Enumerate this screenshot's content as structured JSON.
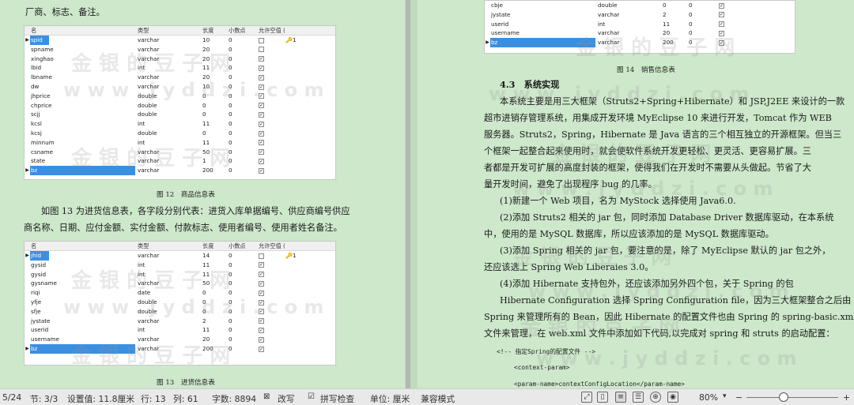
{
  "left": {
    "intro": "厂商、标志、备注。",
    "para": [
      "如图 13 为进货信息表，各字段分别代表：进货入库单据编号、供应商编号供应",
      "商名称、日期、应付金额、实付金额、付款标志、使用者编号、使用者姓名备注。"
    ],
    "cap12": "图 12　商品信息表",
    "cap13": "图 13　进货信息表",
    "headers": [
      "名",
      "类型",
      "长度",
      "小数点",
      "允许空值 (",
      ""
    ],
    "t12": [
      [
        "▶",
        "spid",
        "varchar",
        "10",
        "0",
        false,
        "🔑1"
      ],
      [
        "",
        "spname",
        "varchar",
        "20",
        "0",
        false,
        ""
      ],
      [
        "",
        "xinghao",
        "varchar",
        "20",
        "0",
        true,
        ""
      ],
      [
        "",
        "lbid",
        "int",
        "11",
        "0",
        true,
        ""
      ],
      [
        "",
        "lbname",
        "varchar",
        "20",
        "0",
        true,
        ""
      ],
      [
        "",
        "dw",
        "varchar",
        "10",
        "0",
        true,
        ""
      ],
      [
        "",
        "jhprice",
        "double",
        "0",
        "0",
        true,
        ""
      ],
      [
        "",
        "chprice",
        "double",
        "0",
        "0",
        true,
        ""
      ],
      [
        "",
        "scjj",
        "double",
        "0",
        "0",
        true,
        ""
      ],
      [
        "",
        "kcsl",
        "int",
        "11",
        "0",
        true,
        ""
      ],
      [
        "",
        "kcsj",
        "double",
        "0",
        "0",
        true,
        ""
      ],
      [
        "",
        "minnum",
        "int",
        "11",
        "0",
        true,
        ""
      ],
      [
        "",
        "csname",
        "varchar",
        "50",
        "0",
        true,
        ""
      ],
      [
        "",
        "state",
        "varchar",
        "1",
        "0",
        true,
        ""
      ],
      [
        "▶",
        "bz",
        "varchar",
        "200",
        "0",
        true,
        ""
      ]
    ],
    "t13": [
      [
        "▶",
        "jhid",
        "varchar",
        "14",
        "0",
        false,
        "🔑1"
      ],
      [
        "",
        "gysid",
        "int",
        "11",
        "0",
        true,
        ""
      ],
      [
        "",
        "gysid",
        "int",
        "11",
        "0",
        true,
        ""
      ],
      [
        "",
        "gysname",
        "varchar",
        "50",
        "0",
        true,
        ""
      ],
      [
        "",
        "riqi",
        "date",
        "0",
        "0",
        true,
        ""
      ],
      [
        "",
        "yfje",
        "double",
        "0",
        "0",
        true,
        ""
      ],
      [
        "",
        "sfje",
        "double",
        "0",
        "0",
        true,
        ""
      ],
      [
        "",
        "jystate",
        "varchar",
        "2",
        "0",
        true,
        ""
      ],
      [
        "",
        "userid",
        "int",
        "11",
        "0",
        true,
        ""
      ],
      [
        "",
        "username",
        "varchar",
        "20",
        "0",
        true,
        ""
      ],
      [
        "▶",
        "bz",
        "varchar",
        "200",
        "0",
        true,
        ""
      ]
    ]
  },
  "right": {
    "t14": [
      [
        "",
        "cbje",
        "double",
        "0",
        "0",
        true
      ],
      [
        "",
        "jystate",
        "varchar",
        "2",
        "0",
        true
      ],
      [
        "",
        "userid",
        "int",
        "11",
        "0",
        true
      ],
      [
        "",
        "username",
        "varchar",
        "20",
        "0",
        true
      ],
      [
        "▶",
        "bz",
        "varchar",
        "200",
        "0",
        true
      ]
    ],
    "cap14": "图 14　销售信息表",
    "heading": "4.3　系统实现",
    "p1": [
      "本系统主要是用三大框架（Struts2+Spring+Hibernate）和 JSP,J2EE 来设计的一款",
      "超市进销存管理系统，用集成开发环境 MyEclipse 10 来进行开发，Tomcat 作为 WEB",
      "服务器。Struts2，Spring，Hibernate 是 Java 语言的三个相互独立的开源框架。但当三",
      "个框架一起整合起来使用时，就会使软件系统开发更轻松、更灵活、更容易扩展。三",
      "者都是开发可扩展的高度封装的框架，使得我们在开发时不需要从头做起。节省了大",
      "量开发时间，避免了出现程序 bug 的几率。"
    ],
    "s1": "(1)新建一个 Web 项目，名为 MyStock 选择使用 Java6.0.",
    "s2": [
      "(2)添加 Struts2 相关的 jar 包，同时添加 Database Driver 数据库驱动，在本系统",
      "中，使用的是 MySQL 数据库，所以应该添加的是 MySQL 数据库驱动。"
    ],
    "s3": [
      "(3)添加 Spring 相关的 jar 包，要注意的是，除了 MyEclipse 默认的 jar 包之外，",
      "还应该选上 Spring Web Liberaies 3.0。"
    ],
    "s4": "(4)添加 Hibernate 支持包外，还应该添加另外四个包，关于 Spring 的包",
    "s5": [
      "Hibernate Configuration 选择 Spring Configuration file，因为三大框架整合之后由",
      "Spring 来管理所有的 Bean，因此 Hibernate 的配置文件也由 Spring 的 spring-basic.xml",
      "文件来管理，在 web.xml 文件中添加如下代码,以完成对 spring 和 struts 的启动配置："
    ],
    "code": [
      "<!-- 指定Spring的配置文件 -->",
      "<context-param>",
      "<param-name>contextConfigLocation</param-name>"
    ]
  },
  "watermarks": [
    "金 银 的 豆 子 网",
    "w w w . j y d d z i . c o m"
  ],
  "status": {
    "page": "5/24",
    "section": "节: 3/3",
    "setting": "设置值: 11.8厘米",
    "row": "行: 13",
    "col": "列: 61",
    "words": "字数: 8894",
    "revise": "改写",
    "spell": "拼写检查",
    "unit": "单位: 厘米",
    "compat": "兼容模式",
    "zoom": "80%"
  }
}
